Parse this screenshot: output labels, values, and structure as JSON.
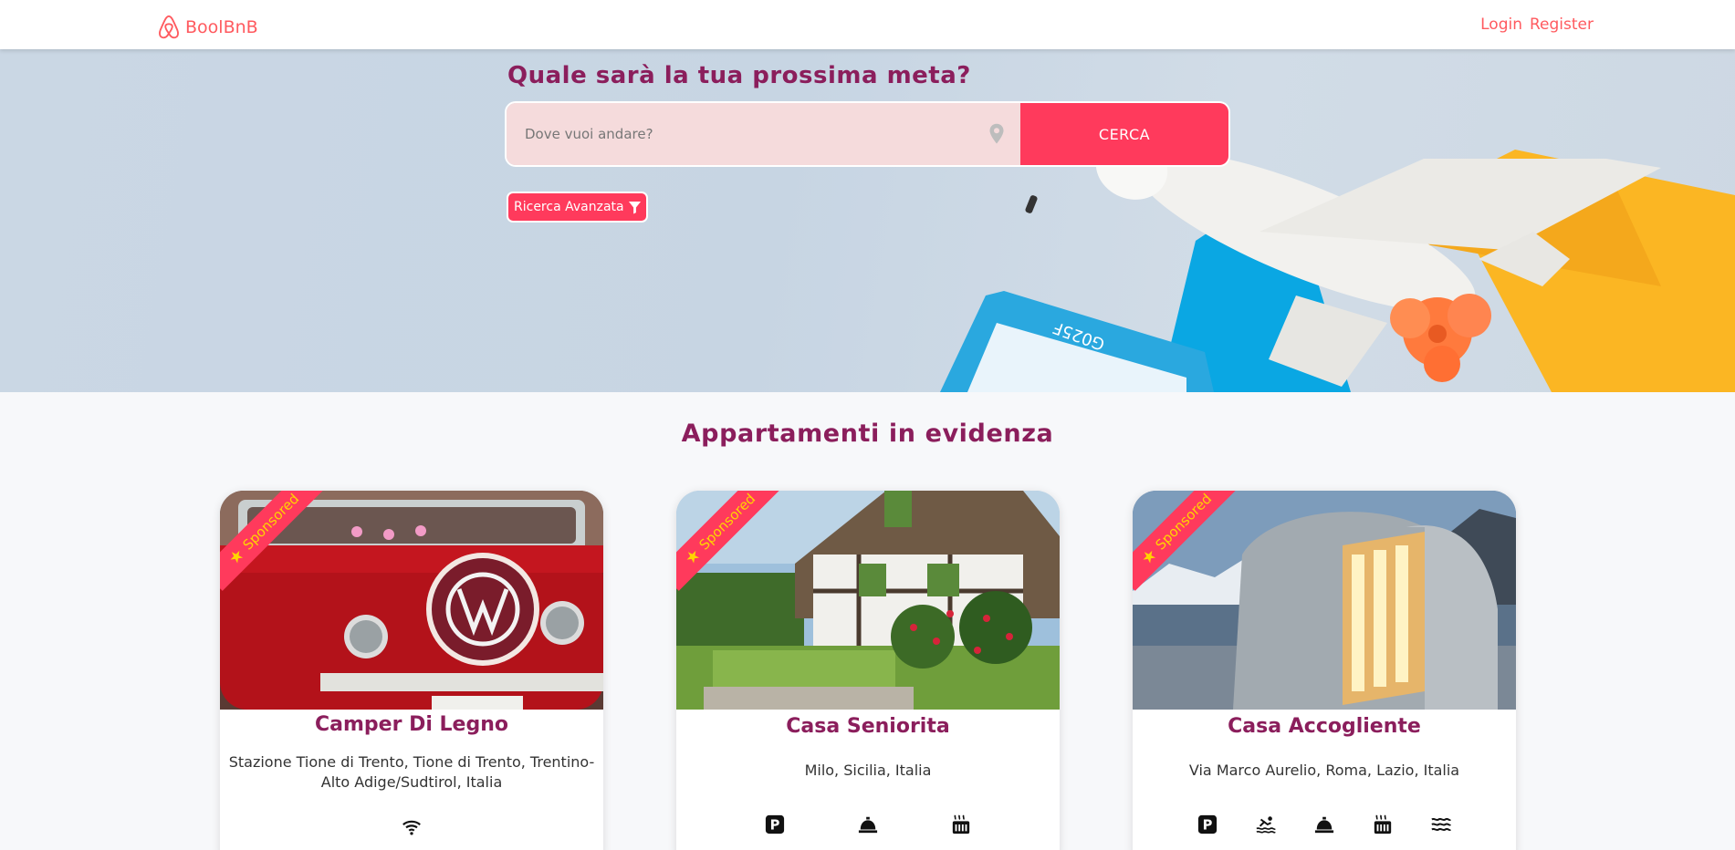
{
  "nav": {
    "brand": "BoolBnB",
    "login": "Login",
    "register": "Register",
    "accent": "#ff5a5f"
  },
  "hero": {
    "title": "Quale sarà la tua prossima meta?",
    "search_placeholder": "Dove vuoi andare?",
    "search_button": "CERCA",
    "advanced_button": "Ricerca Avanzata",
    "accent": "#ff3a5c"
  },
  "featured": {
    "title": "Appartamenti in evidenza",
    "badge": "Sponsored",
    "cards": [
      {
        "title": "Camper Di Legno",
        "address": "Stazione Tione di Trento, Tione di Trento, Trentino-Alto Adige/Sudtirol, Italia",
        "amenities": [
          "wifi-icon"
        ]
      },
      {
        "title": "Casa Seniorita",
        "address": "Milo, Sicilia, Italia",
        "amenities": [
          "parking-icon",
          "reception-bell-icon",
          "sauna-icon"
        ]
      },
      {
        "title": "Casa Accogliente",
        "address": "Via Marco Aurelio, Roma, Lazio, Italia",
        "amenities": [
          "parking-icon",
          "pool-icon",
          "reception-bell-icon",
          "sauna-icon",
          "sea-view-icon"
        ]
      }
    ]
  }
}
